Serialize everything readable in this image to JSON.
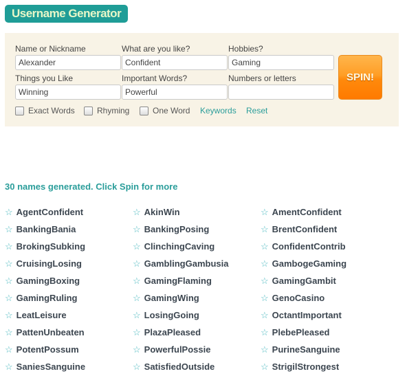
{
  "header": {
    "title": "Username Generator"
  },
  "form": {
    "name": {
      "label": "Name or Nickname",
      "value": "Alexander"
    },
    "like": {
      "label": "What are you like?",
      "value": "Confident"
    },
    "hobbies": {
      "label": "Hobbies?",
      "value": "Gaming"
    },
    "things": {
      "label": "Things you Like",
      "value": "Winning"
    },
    "important": {
      "label": "Important Words?",
      "value": "Powerful"
    },
    "numbers": {
      "label": "Numbers or letters",
      "value": ""
    },
    "spin_label": "SPIN!",
    "options": [
      "Exact Words",
      "Rhyming",
      "One Word"
    ],
    "keywords_link": "Keywords",
    "reset_link": "Reset"
  },
  "results": {
    "status": "30 names generated. Click Spin for more",
    "columns": [
      [
        "AgentConfident",
        "BankingBania",
        "BrokingSubking",
        "CruisingLosing",
        "GamingBoxing",
        "GamingRuling",
        "LeatLeisure",
        "PattenUnbeaten",
        "PotentPossum",
        "SaniesSanguine"
      ],
      [
        "AkinWin",
        "BankingPosing",
        "ClinchingCaving",
        "GamblingGambusia",
        "GamingFlaming",
        "GamingWing",
        "LosingGoing",
        "PlazaPleased",
        "PowerfulPossie",
        "SatisfiedOutside"
      ],
      [
        "AmentConfident",
        "BrentConfident",
        "ConfidentContrib",
        "GambogeGaming",
        "GamingGambit",
        "GenoCasino",
        "OctantImportant",
        "PlebePleased",
        "PurineSanguine",
        "StrigilStrongest"
      ]
    ]
  }
}
